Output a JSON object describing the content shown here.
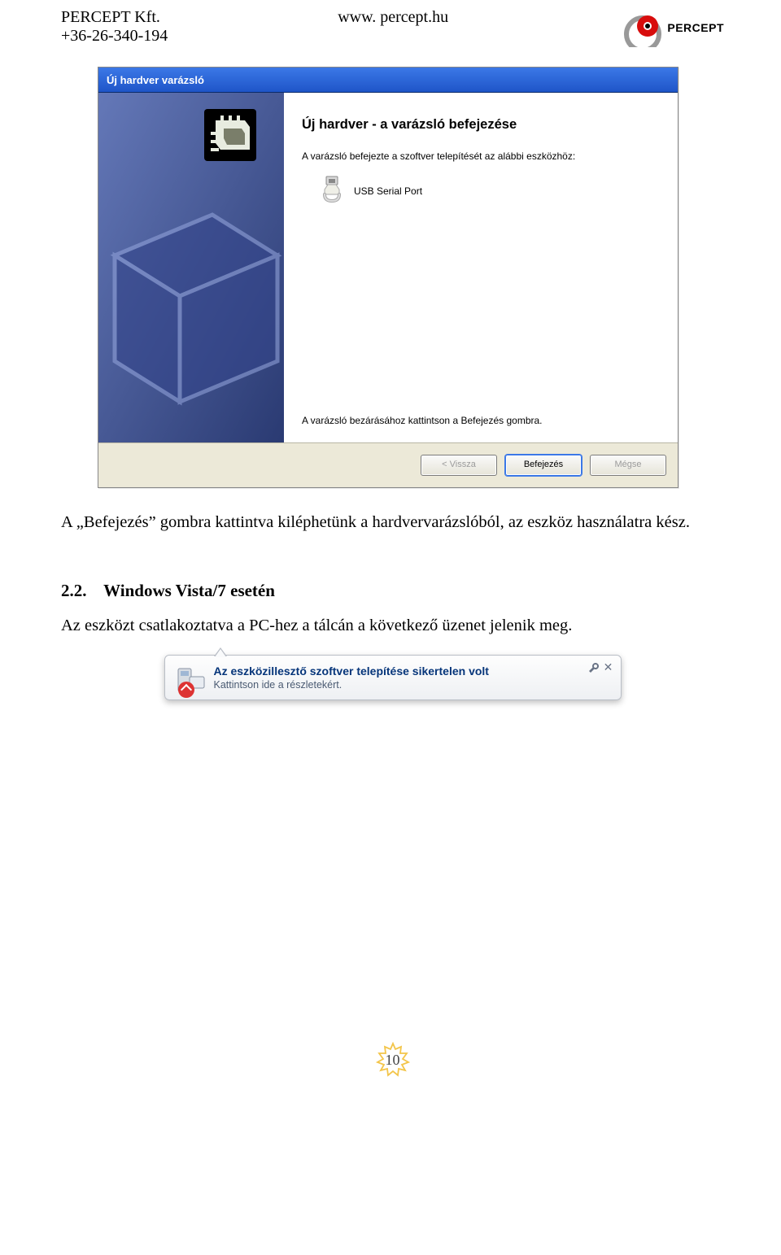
{
  "header": {
    "company": "PERCEPT Kft.",
    "phone": "+36-26-340-194",
    "url": "www. percept.hu",
    "brand": "PERCEPT"
  },
  "wizard": {
    "title": "Új hardver varázsló",
    "heading": "Új hardver - a varázsló befejezése",
    "intro": "A varázsló befejezte a szoftver telepítését az alábbi eszközhöz:",
    "device": "USB Serial Port",
    "footer_text": "A varázsló bezárásához kattintson a Befejezés gombra.",
    "buttons": {
      "back": "< Vissza",
      "finish": "Befejezés",
      "cancel": "Mégse"
    }
  },
  "paragraph1": "A „Befejezés” gombra kattintva kiléphetünk a hardvervarázslóból, az eszköz használatra kész.",
  "section": {
    "number": "2.2.",
    "title": "Windows Vista/7 esetén"
  },
  "paragraph2": "Az eszközt csatlakoztatva a PC-hez a tálcán a következő üzenet jelenik meg.",
  "balloon": {
    "title": "Az eszközillesztő szoftver telepítése sikertelen volt",
    "subtitle": "Kattintson ide a részletekért."
  },
  "page_number": "10"
}
